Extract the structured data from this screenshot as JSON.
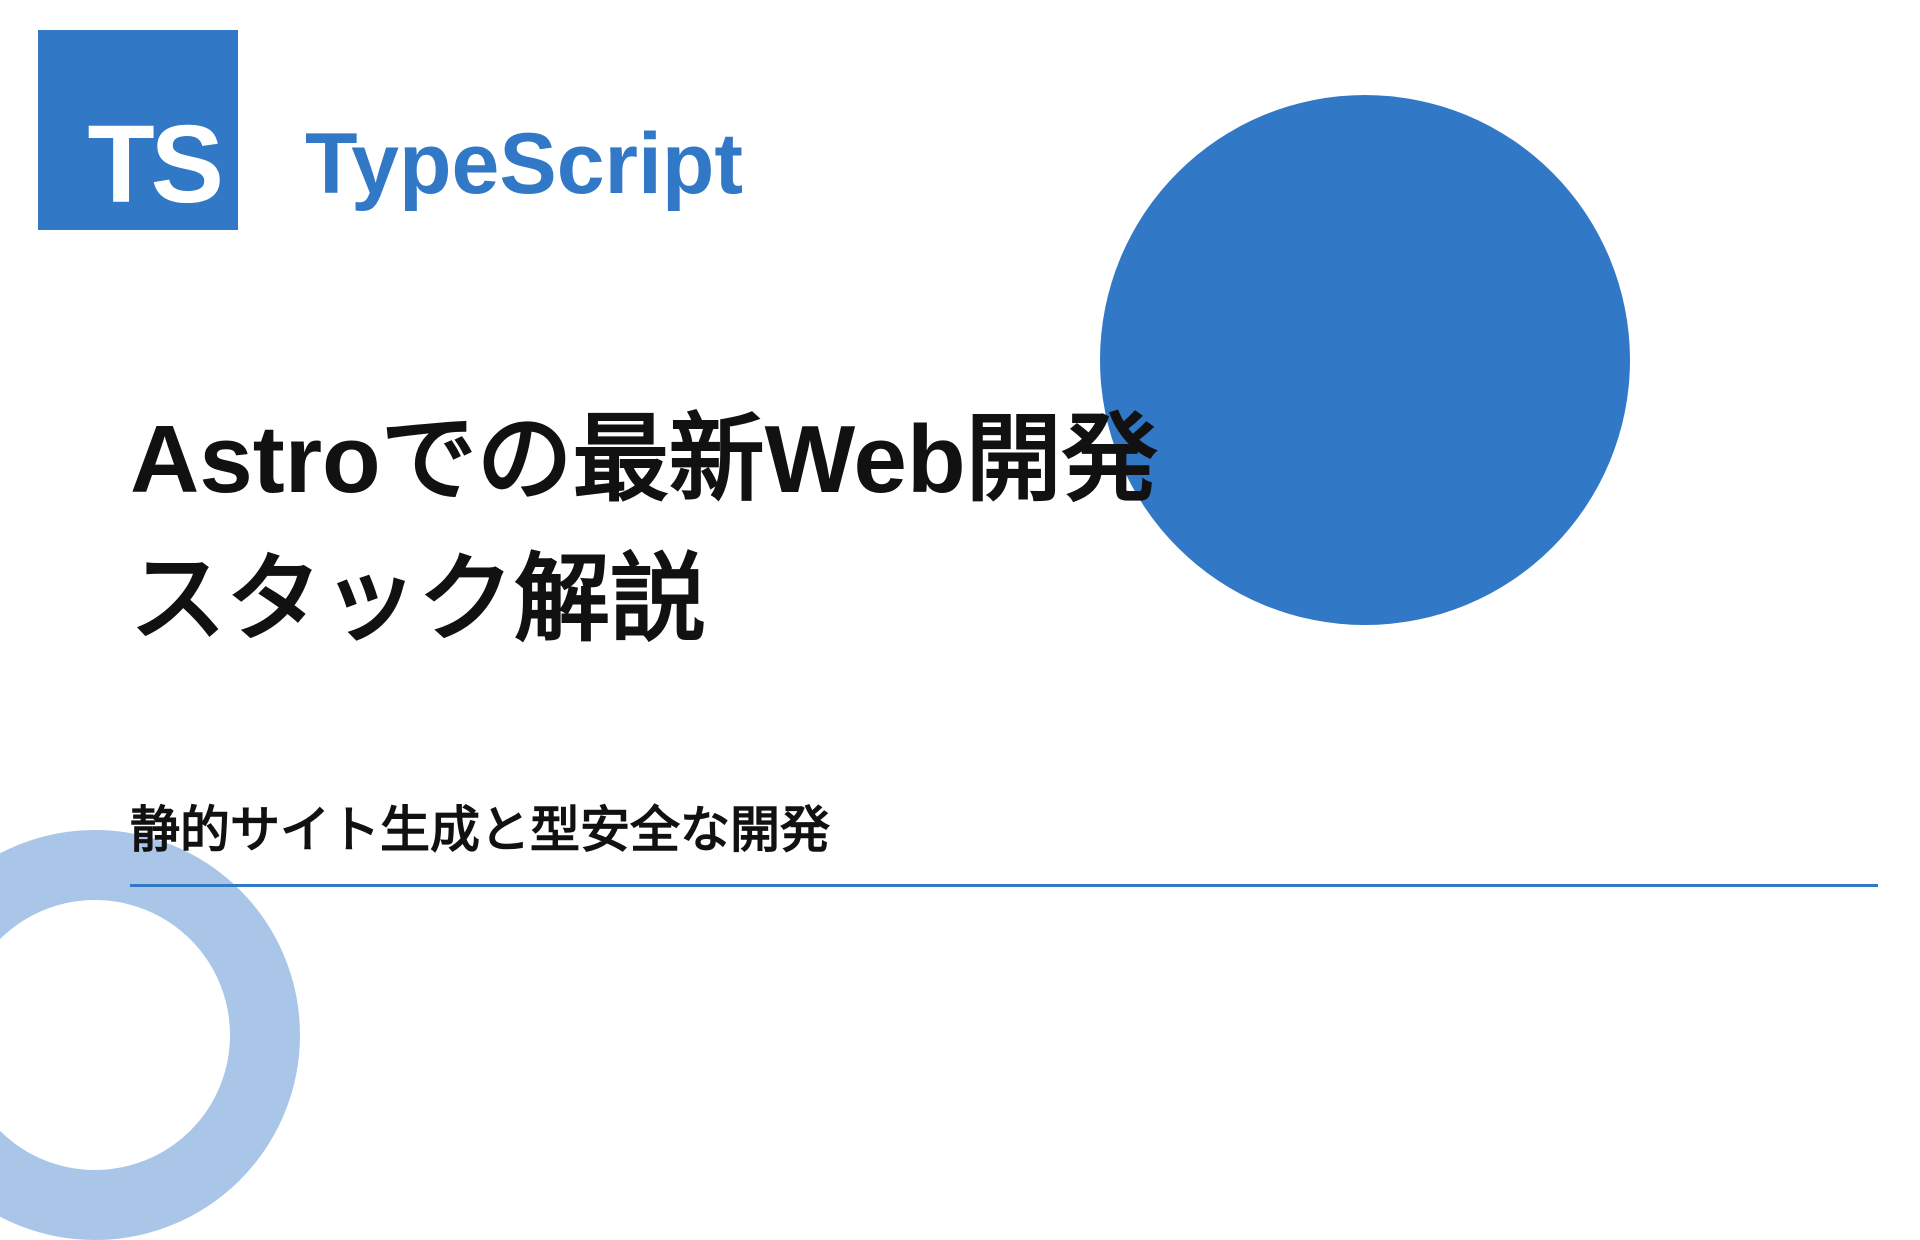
{
  "logo": {
    "text": "TS"
  },
  "brand": "TypeScript",
  "title": "Astroでの最新Web開発スタック解説",
  "subtitle": "静的サイト生成と型安全な開発",
  "colors": {
    "accent": "#3178c6",
    "ring": "#a9c6e8"
  }
}
